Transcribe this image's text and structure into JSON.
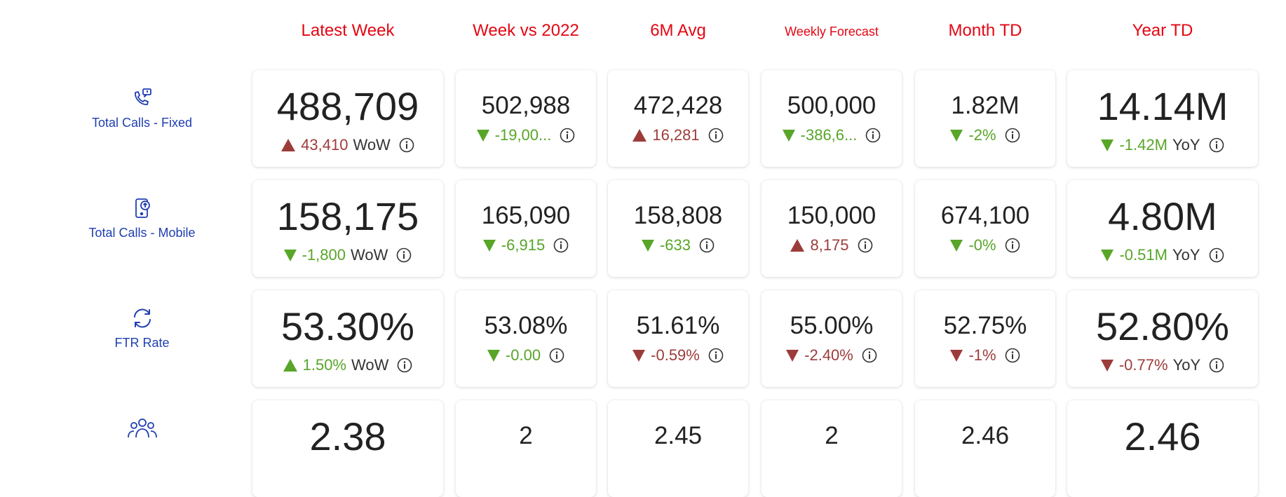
{
  "colors": {
    "header_red": "#e30613",
    "label_blue": "#1f3fb0",
    "good_green": "#58a528",
    "bad_red": "#9c3c3a"
  },
  "headers": [
    "Latest Week",
    "Week vs 2022",
    "6M Avg",
    "Weekly Forecast",
    "Month TD",
    "Year TD"
  ],
  "rows": [
    {
      "label": "Total Calls - Fixed",
      "icon": "phone-chat-icon",
      "cells": [
        {
          "value": "488,709",
          "delta": "43,410",
          "dir": "up",
          "tone": "bad",
          "suffix": "WoW"
        },
        {
          "value": "502,988",
          "delta": "-19,00...",
          "dir": "down",
          "tone": "good",
          "suffix": ""
        },
        {
          "value": "472,428",
          "delta": "16,281",
          "dir": "up",
          "tone": "bad",
          "suffix": ""
        },
        {
          "value": "500,000",
          "delta": "-386,6...",
          "dir": "down",
          "tone": "good",
          "suffix": ""
        },
        {
          "value": "1.82M",
          "delta": "-2%",
          "dir": "down",
          "tone": "good",
          "suffix": ""
        },
        {
          "value": "14.14M",
          "delta": "-1.42M",
          "dir": "down",
          "tone": "good",
          "suffix": "YoY"
        }
      ]
    },
    {
      "label": "Total Calls - Mobile",
      "icon": "mobile-phone-icon",
      "cells": [
        {
          "value": "158,175",
          "delta": "-1,800",
          "dir": "down",
          "tone": "good",
          "suffix": "WoW"
        },
        {
          "value": "165,090",
          "delta": "-6,915",
          "dir": "down",
          "tone": "good",
          "suffix": ""
        },
        {
          "value": "158,808",
          "delta": "-633",
          "dir": "down",
          "tone": "good",
          "suffix": ""
        },
        {
          "value": "150,000",
          "delta": "8,175",
          "dir": "up",
          "tone": "bad",
          "suffix": ""
        },
        {
          "value": "674,100",
          "delta": "-0%",
          "dir": "down",
          "tone": "good",
          "suffix": ""
        },
        {
          "value": "4.80M",
          "delta": "-0.51M",
          "dir": "down",
          "tone": "good",
          "suffix": "YoY"
        }
      ]
    },
    {
      "label": "FTR Rate",
      "icon": "refresh-cycle-icon",
      "cells": [
        {
          "value": "53.30%",
          "delta": "1.50%",
          "dir": "up",
          "tone": "good",
          "suffix": "WoW"
        },
        {
          "value": "53.08%",
          "delta": "-0.00",
          "dir": "down",
          "tone": "good",
          "suffix": ""
        },
        {
          "value": "51.61%",
          "delta": "-0.59%",
          "dir": "down",
          "tone": "bad",
          "suffix": ""
        },
        {
          "value": "55.00%",
          "delta": "-2.40%",
          "dir": "down",
          "tone": "bad",
          "suffix": ""
        },
        {
          "value": "52.75%",
          "delta": "-1%",
          "dir": "down",
          "tone": "bad",
          "suffix": ""
        },
        {
          "value": "52.80%",
          "delta": "-0.77%",
          "dir": "down",
          "tone": "bad",
          "suffix": "YoY"
        }
      ]
    },
    {
      "label": "",
      "icon": "people-group-icon",
      "cells": [
        {
          "value": "2.38"
        },
        {
          "value": "2"
        },
        {
          "value": "2.45"
        },
        {
          "value": "2"
        },
        {
          "value": "2.46"
        },
        {
          "value": "2.46"
        }
      ]
    }
  ]
}
